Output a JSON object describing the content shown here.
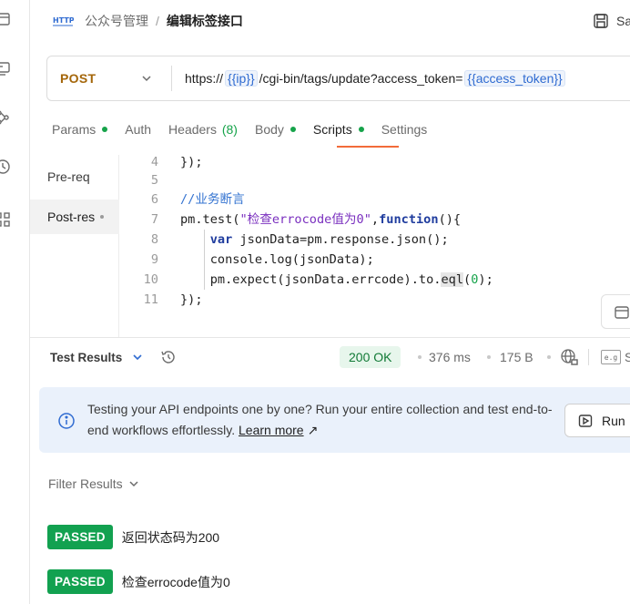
{
  "breadcrumb": {
    "section": "公众号管理",
    "separator": "/",
    "request_name": "编辑标签接口"
  },
  "toolbar": {
    "save_label": "Sa"
  },
  "request": {
    "method": "POST",
    "url_prefix": "https://",
    "var_ip": "{{ip}}",
    "url_path": "/cgi-bin/tags/update?access_token=",
    "var_token": "{{access_token}}"
  },
  "tabs": [
    {
      "label": "Params",
      "has_dot": true
    },
    {
      "label": "Auth"
    },
    {
      "label": "Headers",
      "count": "(8)"
    },
    {
      "label": "Body",
      "has_dot": true
    },
    {
      "label": "Scripts",
      "has_dot": true,
      "active": true
    },
    {
      "label": "Settings"
    }
  ],
  "script_tabs": [
    {
      "label": "Pre-req"
    },
    {
      "label": "Post-res",
      "active": true
    }
  ],
  "code_lines": [
    {
      "n": "4",
      "t": "});"
    },
    {
      "n": "5",
      "t": ""
    },
    {
      "n": "6",
      "t": "//业务断言"
    },
    {
      "n": "7",
      "t": "pm.test(\"检查errocode值为0\",function(){"
    },
    {
      "n": "8",
      "t": "    var jsonData=pm.response.json();"
    },
    {
      "n": "9",
      "t": "    console.log(jsonData);"
    },
    {
      "n": "10",
      "t": "    pm.expect(jsonData.errcode).to.eql(0);"
    },
    {
      "n": "11",
      "t": "});"
    }
  ],
  "response": {
    "test_results_label": "Test Results",
    "status": "200 OK",
    "time": "376 ms",
    "size": "175 B",
    "cut_label": "S",
    "eg_label": "e.g"
  },
  "banner": {
    "text": "Testing your API endpoints one by one? Run your entire collection and test end-to-end workflows effortlessly.",
    "link": "Learn more",
    "arrow": "↗",
    "run_label": "Run"
  },
  "results": {
    "filter_label": "Filter Results",
    "items": [
      {
        "badge": "PASSED",
        "name": "返回状态码为200"
      },
      {
        "badge": "PASSED",
        "name": "检查errocode值为0"
      }
    ]
  },
  "colors": {
    "accent": "#f26b3a",
    "post_method": "#a4660a",
    "variable": "#2f6bd1",
    "passed": "#12a150",
    "status_ok": "#117a36"
  }
}
